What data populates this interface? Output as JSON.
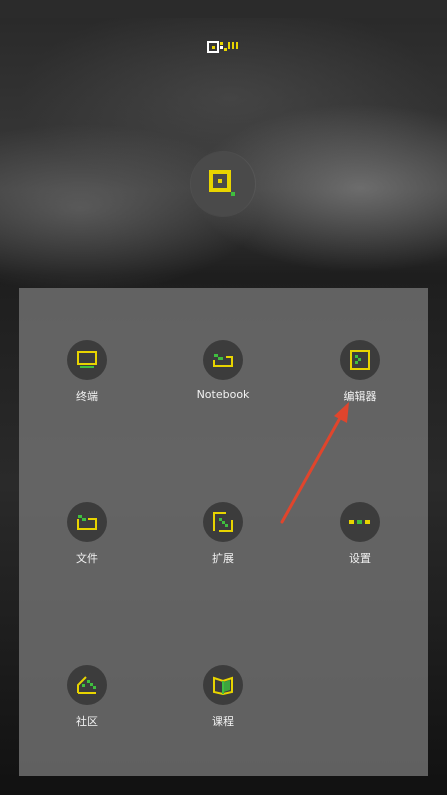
{
  "colors": {
    "accent_yellow": "#e8d400",
    "accent_green": "#3fbf3f",
    "panel_bg": "#6e6e6e",
    "icon_circle": "#3c3c3c",
    "arrow": "#e0452c"
  },
  "apps": [
    {
      "label": "终端",
      "icon": "terminal-icon"
    },
    {
      "label": "Notebook",
      "icon": "notebook-icon"
    },
    {
      "label": "编辑器",
      "icon": "editor-icon"
    },
    {
      "label": "文件",
      "icon": "folder-icon"
    },
    {
      "label": "扩展",
      "icon": "extension-icon"
    },
    {
      "label": "设置",
      "icon": "settings-icon"
    },
    {
      "label": "社区",
      "icon": "community-icon"
    },
    {
      "label": "课程",
      "icon": "course-book-icon"
    }
  ],
  "annotation": {
    "pointing_to": "编辑器"
  }
}
